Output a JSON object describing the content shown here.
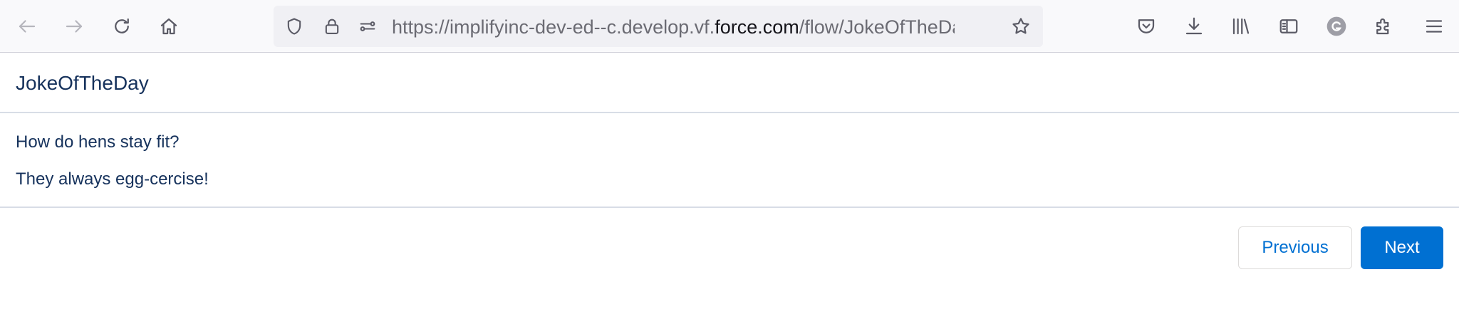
{
  "browser": {
    "nav_icons": [
      "back-arrow-icon",
      "forward-arrow-icon",
      "reload-icon",
      "home-icon"
    ],
    "url_icons": [
      "shield-icon",
      "lock-icon",
      "permissions-icon",
      "bookmark-star-icon"
    ],
    "url": {
      "prefix": "https://implifyinc-dev-ed--c.develop.vf.",
      "host": "force.com",
      "path": "/flow/JokeOfTheDay/",
      "faded": "30"
    },
    "toolbar_icons": [
      "pocket-icon",
      "downloads-icon",
      "library-icon",
      "sidebar-icon",
      "account-avatar-icon",
      "extensions-icon",
      "menu-icon"
    ],
    "colors": {
      "toolbar_bg": "#f9f9fb",
      "urlbar_bg": "#f0f0f4",
      "icon": "#5b5b66"
    }
  },
  "flow": {
    "title": "JokeOfTheDay",
    "question": "How do hens stay fit?",
    "answer": "They always egg-cercise!",
    "buttons": {
      "previous": "Previous",
      "next": "Next"
    },
    "colors": {
      "text": "#16325c",
      "brand": "#0070d2",
      "divider": "#d8dde6"
    }
  }
}
